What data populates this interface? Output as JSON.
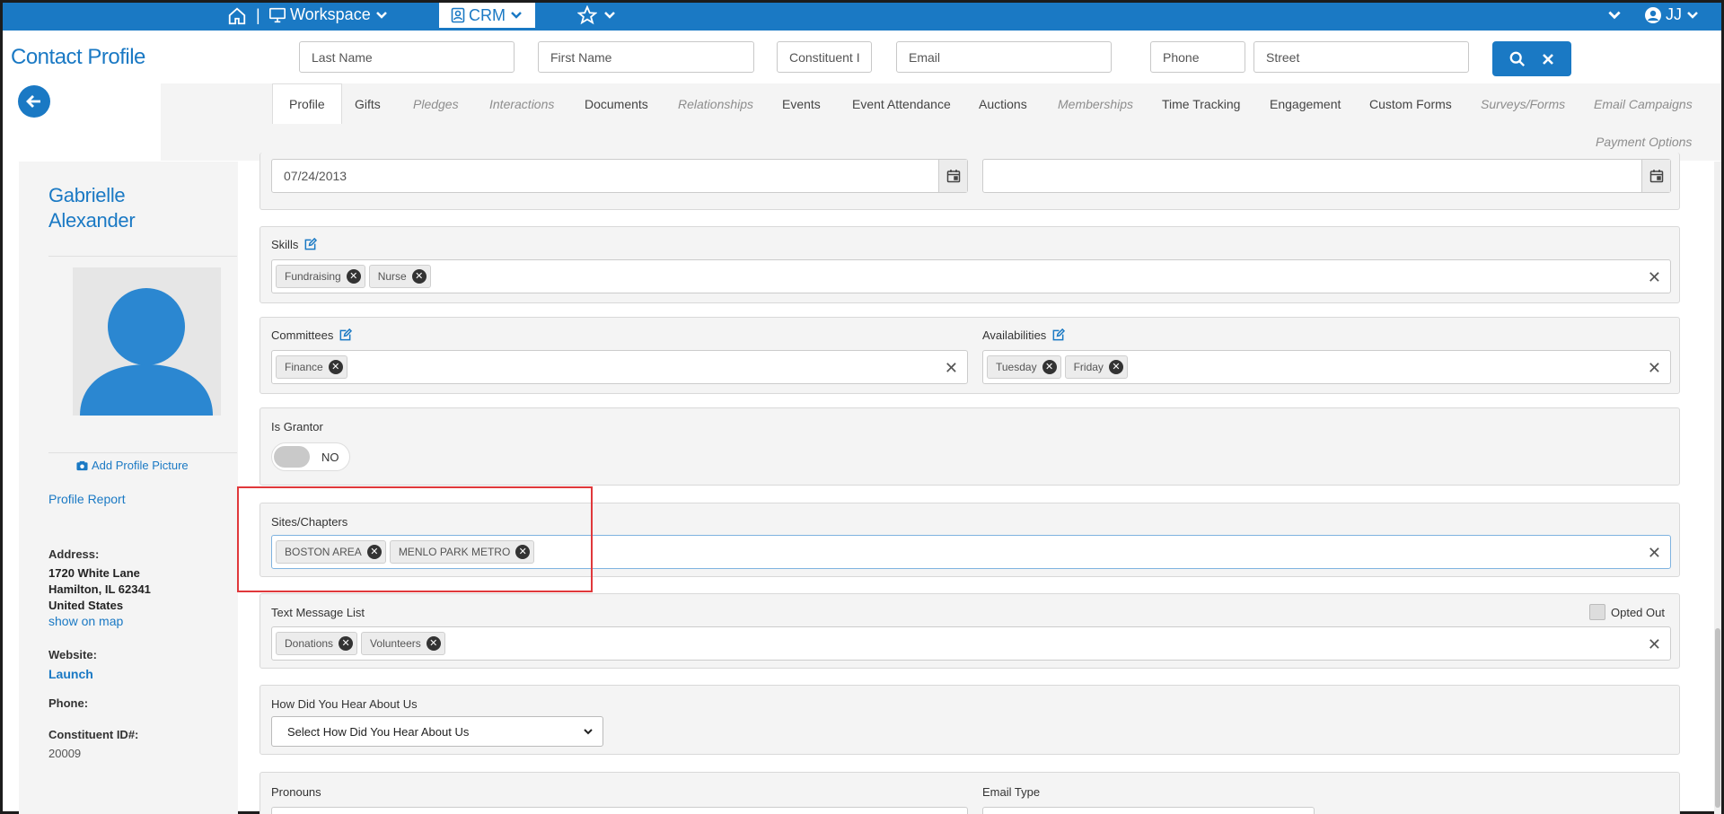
{
  "topbar": {
    "workspace_label": "Workspace",
    "crm_label": "CRM",
    "user_initials": "JJ",
    "separator": "|"
  },
  "page_title": "Contact Profile",
  "search": {
    "last_name_placeholder": "Last Name",
    "first_name_placeholder": "First Name",
    "constituent_id_placeholder": "Constituent II",
    "email_placeholder": "Email",
    "phone_placeholder": "Phone",
    "street_placeholder": "Street"
  },
  "tabs": [
    {
      "label": "Profile",
      "state": "active"
    },
    {
      "label": "Gifts",
      "state": "enabled"
    },
    {
      "label": "Pledges",
      "state": "disabled"
    },
    {
      "label": "Interactions",
      "state": "disabled"
    },
    {
      "label": "Documents",
      "state": "enabled"
    },
    {
      "label": "Relationships",
      "state": "disabled"
    },
    {
      "label": "Events",
      "state": "enabled"
    },
    {
      "label": "Event Attendance",
      "state": "enabled"
    },
    {
      "label": "Auctions",
      "state": "enabled"
    },
    {
      "label": "Memberships",
      "state": "disabled"
    },
    {
      "label": "Time Tracking",
      "state": "enabled"
    },
    {
      "label": "Engagement",
      "state": "enabled"
    },
    {
      "label": "Custom Forms",
      "state": "enabled"
    },
    {
      "label": "Surveys/Forms",
      "state": "disabled"
    },
    {
      "label": "Email Campaigns",
      "state": "disabled"
    },
    {
      "label": "Payment Options",
      "state": "disabled"
    }
  ],
  "contact": {
    "first_name": "Gabrielle",
    "last_name": "Alexander",
    "add_picture_label": "Add Profile Picture",
    "profile_report_label": "Profile Report",
    "address_label": "Address:",
    "address_line1": "1720 White Lane",
    "address_line2": "Hamilton, IL 62341",
    "address_country": "United States",
    "show_on_map_label": "show on map",
    "website_label": "Website:",
    "website_link": "Launch",
    "phone_label": "Phone:",
    "constituent_id_label": "Constituent ID#:",
    "constituent_id": "20009"
  },
  "form": {
    "date_value": "07/24/2013",
    "date_value_2": "",
    "skills": {
      "label": "Skills",
      "tags": [
        "Fundraising",
        "Nurse"
      ]
    },
    "committees": {
      "label": "Committees",
      "tags": [
        "Finance"
      ]
    },
    "availabilities": {
      "label": "Availabilities",
      "tags": [
        "Tuesday",
        "Friday"
      ]
    },
    "is_grantor": {
      "label": "Is Grantor",
      "value": "NO"
    },
    "sites_chapters": {
      "label": "Sites/Chapters",
      "tags": [
        "BOSTON AREA",
        "MENLO PARK METRO"
      ]
    },
    "text_message_list": {
      "label": "Text Message List",
      "opted_out_label": "Opted Out",
      "tags": [
        "Donations",
        "Volunteers"
      ]
    },
    "how_heard": {
      "label": "How Did You Hear About Us",
      "selected": "Select How Did You Hear About Us"
    },
    "pronouns": {
      "label": "Pronouns"
    },
    "email_type": {
      "label": "Email Type"
    }
  },
  "colors": {
    "brand": "#1a79c4",
    "highlight": "#e0383b"
  }
}
